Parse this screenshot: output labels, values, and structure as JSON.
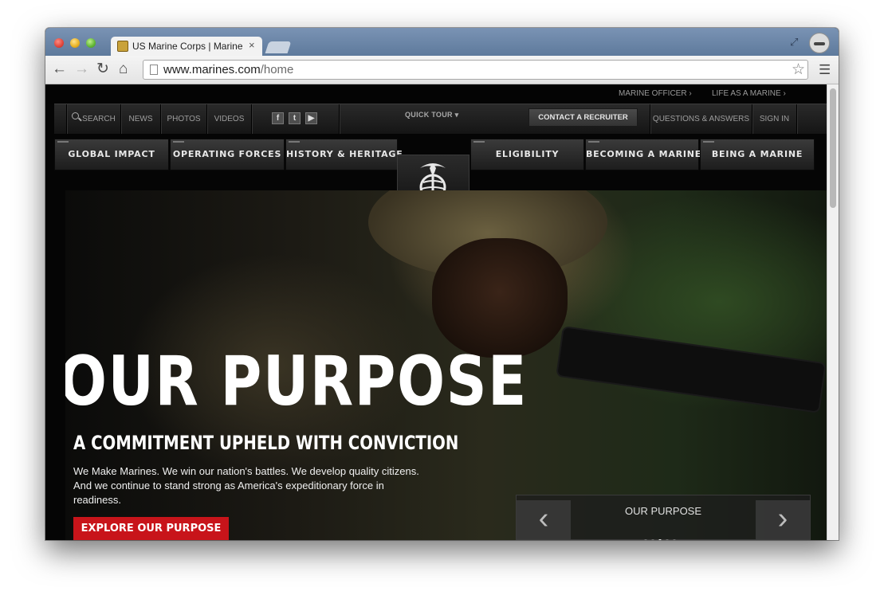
{
  "browser": {
    "tab_title": "US Marine Corps | Marine Corps",
    "tab_close": "×",
    "url_host": "www.marines.com",
    "url_path": "/home"
  },
  "site": {
    "utility_links": [
      "MARINE OFFICER ›",
      "LIFE AS A MARINE ›"
    ],
    "secondary": {
      "search": "SEARCH",
      "news": "NEWS",
      "photos": "PHOTOS",
      "videos": "VIDEOS",
      "quick_tour": "QUICK TOUR ▾",
      "contact": "CONTACT A RECRUITER",
      "qa": "QUESTIONS & ANSWERS",
      "sign_in": "SIGN IN"
    },
    "main_nav": [
      "GLOBAL IMPACT",
      "OPERATING FORCES",
      "HISTORY & HERITAGE",
      "ELIGIBILITY",
      "BECOMING A MARINE",
      "BEING A MARINE"
    ]
  },
  "hero": {
    "title": "OUR PURPOSE",
    "subtitle": "A COMMITMENT UPHELD WITH CONVICTION",
    "body": "We Make Marines. We win our nation's battles. We develop quality citizens. And we continue to stand strong as America's expeditionary force in readiness.",
    "cta": "EXPLORE OUR PURPOSE",
    "carousel_label": "OUR PURPOSE",
    "carousel_slides": 5,
    "carousel_active": 3
  }
}
